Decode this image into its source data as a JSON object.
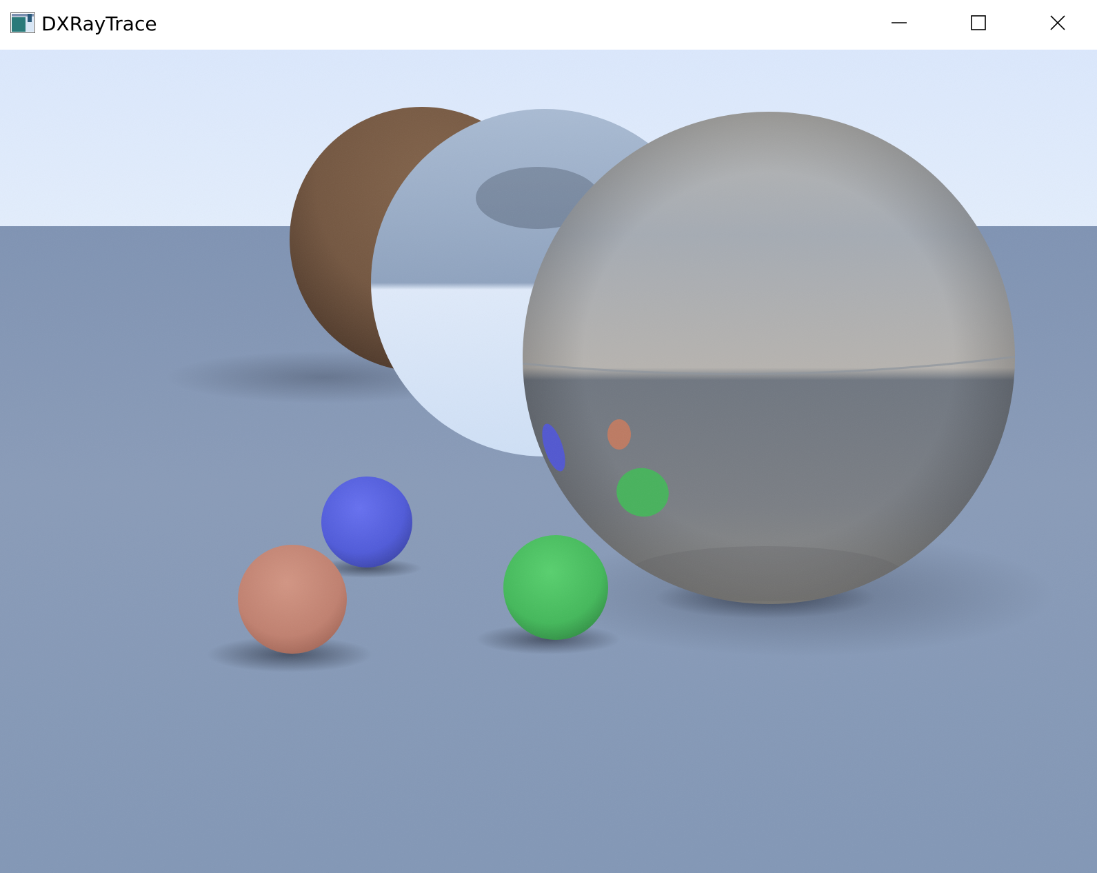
{
  "window": {
    "title": "DXRayTrace",
    "app_icon": "app-window-icon",
    "controls": {
      "minimize_icon": "minimize-icon",
      "maximize_icon": "maximize-icon",
      "close_icon": "close-icon"
    }
  },
  "scene": {
    "sky_color": "#dce9fd",
    "ground_color": "#8196b6",
    "spheres": [
      {
        "name": "brown-diffuse-sphere",
        "color": "#7a5a44"
      },
      {
        "name": "frosted-glass-sphere",
        "color": "#c6d8ef"
      },
      {
        "name": "mirror-sphere",
        "color": "#9aa3ad"
      },
      {
        "name": "blue-diffuse-sphere",
        "color": "#5561e4"
      },
      {
        "name": "salmon-diffuse-sphere",
        "color": "#c98878"
      },
      {
        "name": "green-diffuse-sphere",
        "color": "#4bc362"
      }
    ]
  }
}
